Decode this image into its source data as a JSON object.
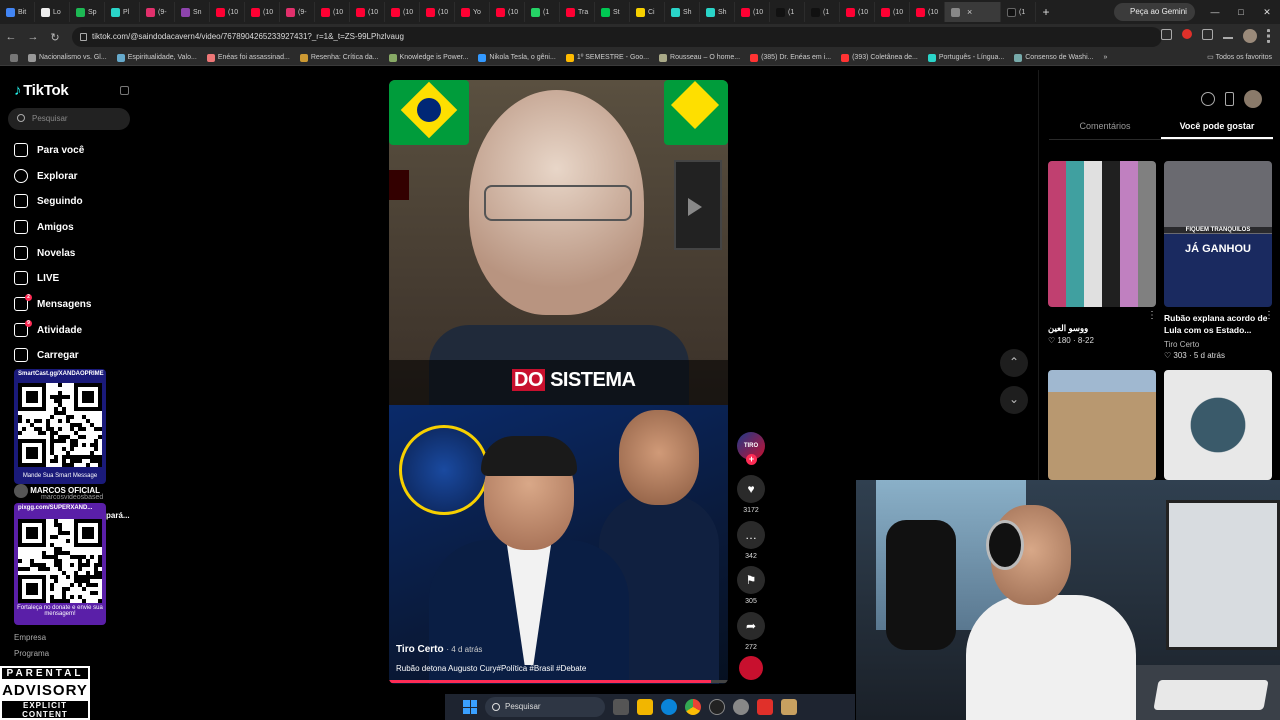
{
  "browser": {
    "tabs": [
      {
        "label": "Bit",
        "color": "#4285f4"
      },
      {
        "label": "Lo",
        "color": "#eeeeee"
      },
      {
        "label": "Sp",
        "color": "#1db954"
      },
      {
        "label": "Pl",
        "color": "#2ad4c8"
      },
      {
        "label": "(9-",
        "color": "#e1306c"
      },
      {
        "label": "Sn",
        "color": "#8e44ad"
      },
      {
        "label": "(10",
        "color": "#ff0033"
      },
      {
        "label": "(10",
        "color": "#ff0033"
      },
      {
        "label": "(9-",
        "color": "#e1306c"
      },
      {
        "label": "(10",
        "color": "#ff0033"
      },
      {
        "label": "(10",
        "color": "#ff0033"
      },
      {
        "label": "(10",
        "color": "#ff0033"
      },
      {
        "label": "(10",
        "color": "#ff0033"
      },
      {
        "label": "Yo",
        "color": "#ff0033"
      },
      {
        "label": "(10",
        "color": "#ff0033"
      },
      {
        "label": "(1",
        "color": "#25d366"
      },
      {
        "label": "Tra",
        "color": "#ff0033"
      },
      {
        "label": "St",
        "color": "#00c853"
      },
      {
        "label": "Ci",
        "color": "#f7d000"
      },
      {
        "label": "Sh",
        "color": "#2ad4c8"
      },
      {
        "label": "Sh",
        "color": "#2ad4c8"
      },
      {
        "label": "(10",
        "color": "#ff0033"
      },
      {
        "label": "(1",
        "color": "#111111"
      },
      {
        "label": "(1",
        "color": "#111111"
      },
      {
        "label": "(10",
        "color": "#ff0033"
      },
      {
        "label": "(10",
        "color": "#ff0033"
      },
      {
        "label": "(10",
        "color": "#ff0033"
      }
    ],
    "active_tab": {
      "label": "",
      "close": "×"
    },
    "last_tab": {
      "label": "(1"
    },
    "new_tab": "+",
    "gemini_button": "Peça ao Gemini",
    "window_controls": [
      "—",
      "□",
      "✕"
    ],
    "url": "tiktok.com/@saindodacavern4/video/7678904265233927431?_r=1&_t=ZS-99LPhzlvaug",
    "bookmarks": [
      "Nacionalismo vs. Gl...",
      "Espiritualidade, Valo...",
      "Enéas foi assassinad...",
      "Resenha: Crítica da...",
      "Knowledge is Power...",
      "Nikola Tesla, o gêni...",
      "1º SEMESTRE - Goo...",
      "Rousseau – O home...",
      "(385) Dr. Enéas em i...",
      "(393) Coletânea de...",
      "Português - Língua...",
      "Consenso de Washi..."
    ],
    "bookmarks_all": "Todos os favoritos",
    "bookmarks_more": "»"
  },
  "sidebar": {
    "logo": "TikTok",
    "search_placeholder": "Pesquisar",
    "nav": [
      {
        "label": "Para você",
        "icon": "home-icon"
      },
      {
        "label": "Explorar",
        "icon": "compass-icon"
      },
      {
        "label": "Seguindo",
        "icon": "following-icon"
      },
      {
        "label": "Amigos",
        "icon": "friends-icon"
      },
      {
        "label": "Novelas",
        "icon": "novelas-icon"
      },
      {
        "label": "LIVE",
        "icon": "live-icon"
      },
      {
        "label": "Mensagens",
        "icon": "messages-icon",
        "badge": "2"
      },
      {
        "label": "Atividade",
        "icon": "activity-icon",
        "badge": "9"
      },
      {
        "label": "Carregar",
        "icon": "upload-icon"
      }
    ],
    "overlay_user": {
      "name": "MARCOS OFICIAL",
      "handle": "marcosvideosbased",
      "extra": "pará..."
    },
    "footer": [
      "Empresa",
      "Programa"
    ]
  },
  "overlays": {
    "qr1_url": "SmartCast.gg/XANDAOPRIME",
    "qr1_note": "Mande Sua Smart Message",
    "qr2_url": "pixgg.com/SUPERXAND...",
    "qr2_note": "Fortaleça no donate e envie sua mensagem!",
    "advisory": {
      "line1": "PARENTAL",
      "line2": "ADVISORY",
      "line3": "EXPLICIT CONTENT"
    }
  },
  "video": {
    "caption": {
      "highlight": "DO",
      "rest": "SISTEMA"
    },
    "author": "Tiro Certo",
    "time": "· 4 d atrás",
    "description": "Rubão detona Augusto Cury#Política #Brasil #Debate",
    "progress": 0.95
  },
  "actions": {
    "avatar_text": "TIRO",
    "follow": "+",
    "like": {
      "icon": "♥",
      "count": "3172"
    },
    "comment": {
      "icon": "…",
      "count": "342"
    },
    "save": {
      "icon": "⚑",
      "count": "305"
    },
    "share": {
      "icon": "➦",
      "count": "272"
    }
  },
  "scroll": {
    "up": "⌃",
    "down": "⌄"
  },
  "right_panel": {
    "tabs": [
      "Comentários",
      "Você pode gostar"
    ],
    "active_tab": 1,
    "items": [
      {
        "title": "ووسو العين",
        "meta": "",
        "likes": "180",
        "date": "8-22"
      },
      {
        "title": "Rubão explana acordo de Lula com os Estado...",
        "meta": "Tiro Certo",
        "likes": "303",
        "date": "5 d atrás",
        "overlay1": "FIQUEM TRANQUILOS",
        "overlay2": "JÁ GANHOU"
      }
    ]
  },
  "taskbar": {
    "search": "Pesquisar"
  }
}
